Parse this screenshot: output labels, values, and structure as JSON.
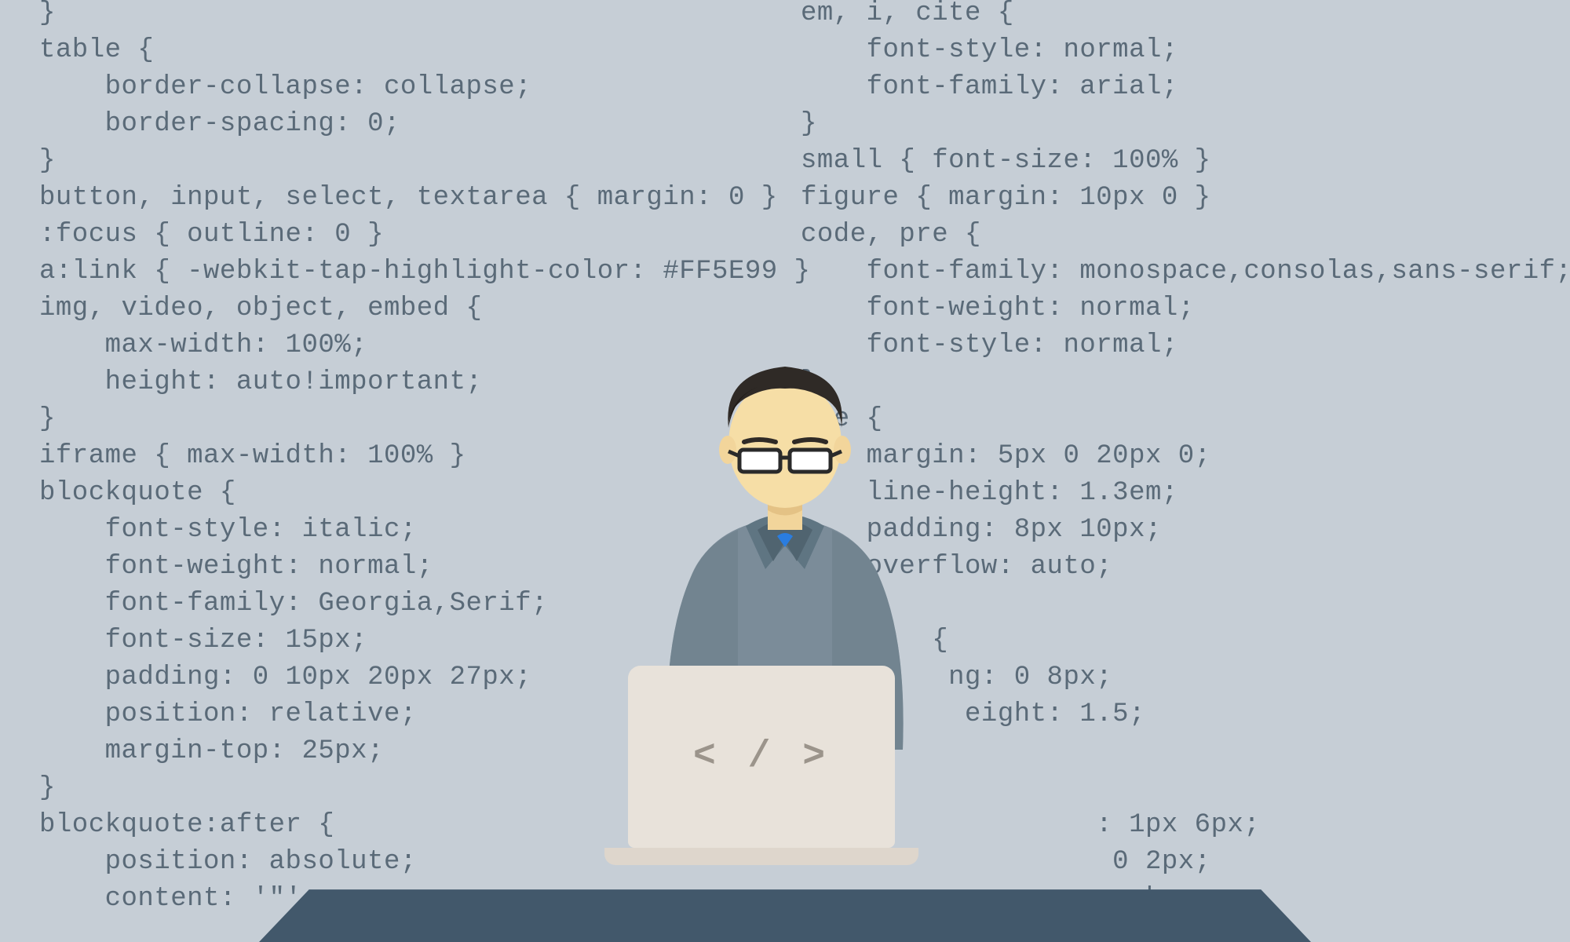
{
  "codeLeft": "}\ntable {\n    border-collapse: collapse;\n    border-spacing: 0;\n}\nbutton, input, select, textarea { margin: 0 }\n:focus { outline: 0 }\na:link { -webkit-tap-highlight-color: #FF5E99 }\nimg, video, object, embed {\n    max-width: 100%;\n    height: auto!important;\n}\niframe { max-width: 100% }\nblockquote {\n    font-style: italic;\n    font-weight: normal;\n    font-family: Georgia,Serif;\n    font-size: 15px;\n    padding: 0 10px 20px 27px;\n    position: relative;\n    margin-top: 25px;\n}\nblockquote:after {\n    position: absolute;\n    content: '\"';",
  "codeRight": "em, i, cite {\n    font-style: normal;\n    font-family: arial;\n}\nsmall { font-size: 100% }\nfigure { margin: 10px 0 }\ncode, pre {\n    font-family: monospace,consolas,sans-serif;\n    font-weight: normal;\n    font-style: normal;\n}\npre {\n    margin: 5px 0 20px 0;\n    line-height: 1.3em;\n    padding: 8px 10px;\n    overflow: auto;\n}\n        {\n         ng: 0 8px;\n          eight: 1.5;\n\n\n                  : 1px 6px;\n                   0 2px;\n                   ack;",
  "laptopLogo": "< / >"
}
